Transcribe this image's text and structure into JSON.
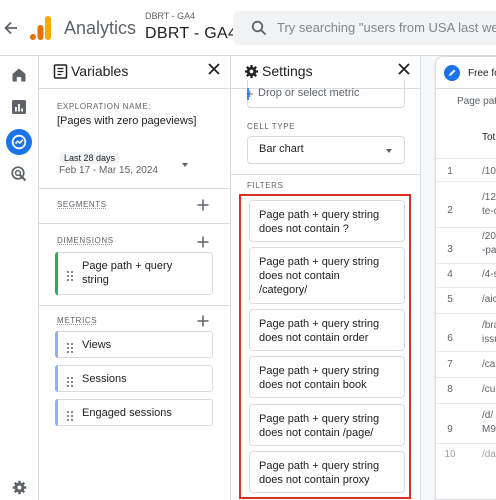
{
  "topbar": {
    "app_name": "Analytics",
    "account_small": "DBRT - GA4",
    "account_big": "DBRT - GA4",
    "search_placeholder": "Try searching \"users from USA last week\""
  },
  "variables_panel": {
    "title": "Variables",
    "exploration_name_label": "EXPLORATION NAME:",
    "exploration_name": "[Pages with zero pageviews]",
    "date_label": "Last 28 days",
    "date_range": "Feb 17 - Mar 15, 2024",
    "segments_label": "SEGMENTS",
    "dimensions_label": "DIMENSIONS",
    "dimensions": [
      {
        "line1": "Page path + query",
        "line2": "string"
      }
    ],
    "metrics_label": "METRICS",
    "metrics": [
      "Views",
      "Sessions",
      "Engaged sessions"
    ]
  },
  "settings_panel": {
    "title": "Settings",
    "drop_metric": "Drop or select metric",
    "cell_type_label": "CELL TYPE",
    "cell_type_value": "Bar chart",
    "filters_label": "FILTERS",
    "filters": [
      {
        "line1": "Page path + query string",
        "line2": "does not contain ?"
      },
      {
        "line1": "Page path + query string",
        "line2": "does not contain",
        "line3": "/category/"
      },
      {
        "line1": "Page path + query string",
        "line2": "does not contain order"
      },
      {
        "line1": "Page path + query string",
        "line2": "does not contain book"
      },
      {
        "line1": "Page path + query string",
        "line2": "does not contain /page/"
      },
      {
        "line1": "Page path + query string",
        "line2": "does not contain proxy"
      }
    ]
  },
  "table_panel": {
    "tab_title": "Free fo",
    "column_sub": "Page path",
    "column_head": "Tot",
    "rows": [
      {
        "num": "1",
        "l1": "/10",
        "l2": ""
      },
      {
        "num": "2",
        "l1": "/12",
        "l2": "te-c"
      },
      {
        "num": "3",
        "l1": "/20",
        "l2": "-pa"
      },
      {
        "num": "4",
        "l1": "/4-s",
        "l2": ""
      },
      {
        "num": "5",
        "l1": "/aic",
        "l2": ""
      },
      {
        "num": "6",
        "l1": "/bra",
        "l2": "issu"
      },
      {
        "num": "7",
        "l1": "/ca",
        "l2": ""
      },
      {
        "num": "8",
        "l1": "/cu",
        "l2": ""
      },
      {
        "num": "9",
        "l1": "/d/",
        "l2": "M9"
      },
      {
        "num": "10",
        "l1": "/da",
        "l2": ""
      }
    ]
  },
  "colors": {
    "accent_blue": "#1a73e8",
    "dimension_green": "#34a853",
    "metric_blue": "#8ab4f8",
    "highlight_red": "#d93025"
  },
  "icons": [
    "back-arrow-icon",
    "analytics-logo-icon",
    "search-icon",
    "home-icon",
    "reports-icon",
    "explore-icon",
    "advertising-icon",
    "admin-gear-icon",
    "variables-icon",
    "settings-gear-icon",
    "close-icon",
    "plus-icon",
    "drag-handle-icon",
    "dropdown-caret-icon",
    "edit-pencil-icon"
  ]
}
